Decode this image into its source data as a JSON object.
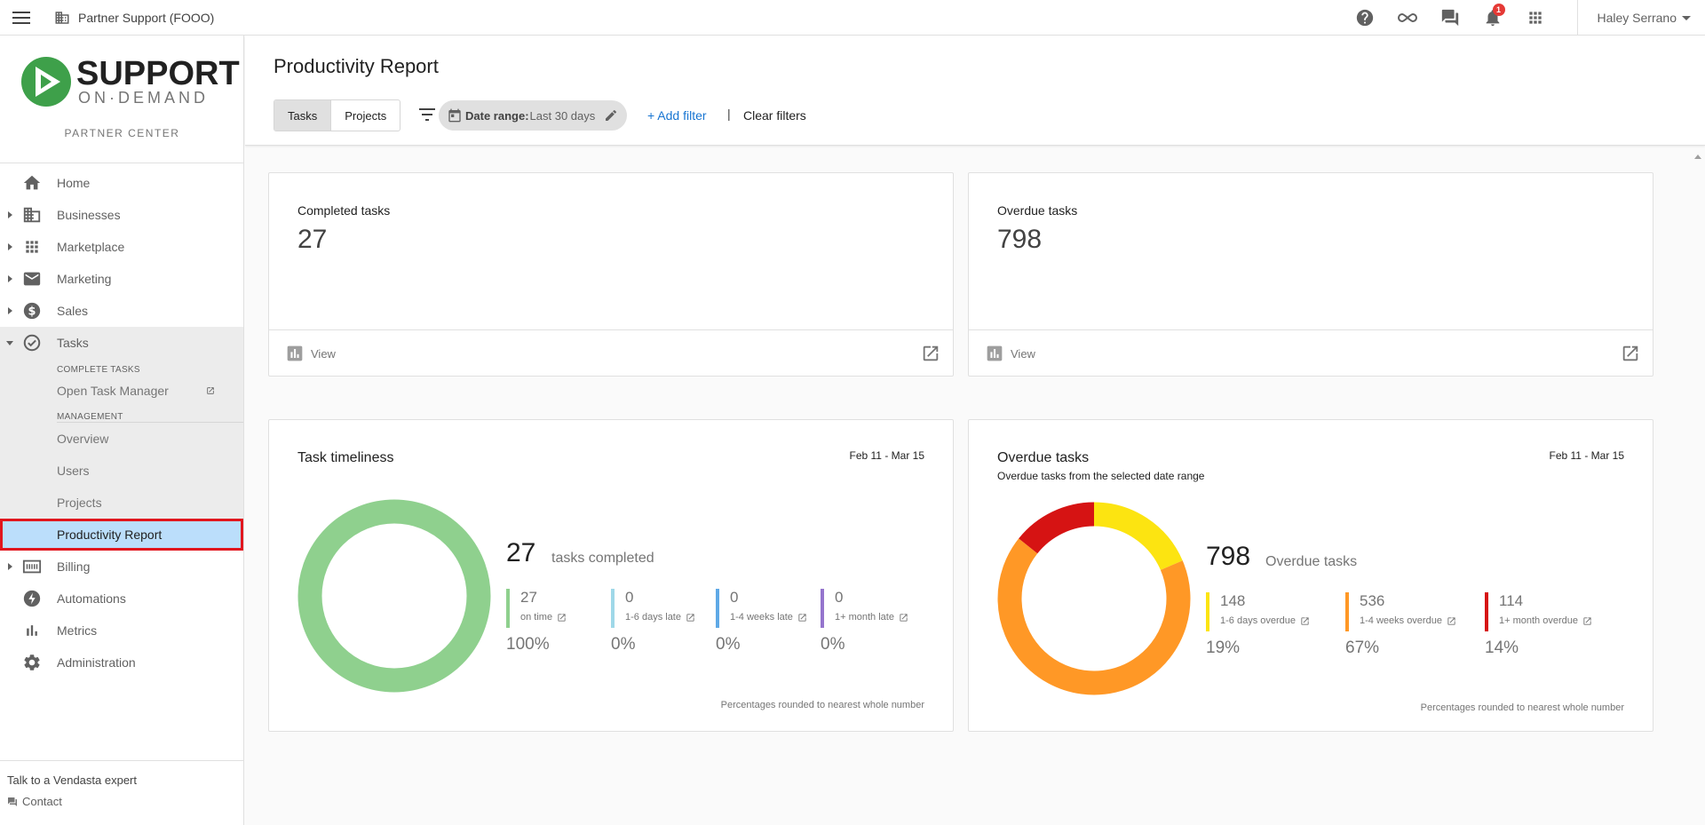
{
  "topbar": {
    "partner_name": "Partner Support (FOOO)",
    "notification_count": "1",
    "user_name": "Haley Serrano"
  },
  "sidebar": {
    "logo_support": "SUPPORT",
    "logo_ondemand": "ON·DEMAND",
    "partner_center": "PARTNER CENTER",
    "items": [
      {
        "label": "Home",
        "icon": "home-icon"
      },
      {
        "label": "Businesses",
        "icon": "building-icon"
      },
      {
        "label": "Marketplace",
        "icon": "apps-grid-icon"
      },
      {
        "label": "Marketing",
        "icon": "mail-icon"
      },
      {
        "label": "Sales",
        "icon": "dollar-icon"
      },
      {
        "label": "Tasks",
        "icon": "check-circle-icon"
      },
      {
        "label": "Billing",
        "icon": "billing-icon"
      },
      {
        "label": "Automations",
        "icon": "bolt-icon"
      },
      {
        "label": "Metrics",
        "icon": "bar-chart-icon"
      },
      {
        "label": "Administration",
        "icon": "gear-icon"
      }
    ],
    "tasks_sub": {
      "complete_head": "COMPLETE TASKS",
      "open_task_manager": "Open Task Manager",
      "management_head": "MANAGEMENT",
      "overview": "Overview",
      "users": "Users",
      "projects": "Projects",
      "productivity_report": "Productivity Report"
    },
    "talk": "Talk to a Vendasta expert",
    "contact": "Contact"
  },
  "header": {
    "title": "Productivity Report",
    "toggle_tasks": "Tasks",
    "toggle_projects": "Projects",
    "date_range_label": "Date range:",
    "date_range_value": "Last 30 days",
    "add_filter": "+ Add filter",
    "separator": "|",
    "clear_filters": "Clear filters"
  },
  "cards": {
    "completed": {
      "label": "Completed tasks",
      "value": "27",
      "view": "View"
    },
    "overdue": {
      "label": "Overdue tasks",
      "value": "798",
      "view": "View"
    }
  },
  "timeliness": {
    "title": "Task timeliness",
    "date": "Feb 11 - Mar 15",
    "total": "27",
    "total_label": "tasks completed",
    "stats": [
      {
        "value": "27",
        "label": "on time",
        "pct": "100%",
        "color": "#8fd08e"
      },
      {
        "value": "0",
        "label": "1-6 days late",
        "pct": "0%",
        "color": "#9fd8e8"
      },
      {
        "value": "0",
        "label": "1-4 weeks late",
        "pct": "0%",
        "color": "#5fa9e6"
      },
      {
        "value": "0",
        "label": "1+ month late",
        "pct": "0%",
        "color": "#9575cd"
      }
    ],
    "note": "Percentages rounded to nearest whole number"
  },
  "overdue_panel": {
    "title": "Overdue tasks",
    "subtitle": "Overdue tasks from the selected date range",
    "date": "Feb 11 - Mar 15",
    "total": "798",
    "total_label": "Overdue tasks",
    "stats": [
      {
        "value": "148",
        "label": "1-6 days overdue",
        "pct": "19%",
        "fraction": 0.1855,
        "color": "#fce411"
      },
      {
        "value": "536",
        "label": "1-4 weeks overdue",
        "pct": "67%",
        "fraction": 0.6717,
        "color": "#ff9826"
      },
      {
        "value": "114",
        "label": "1+ month overdue",
        "pct": "14%",
        "fraction": 0.1429,
        "color": "#d61313"
      }
    ],
    "note": "Percentages rounded to nearest whole number"
  }
}
